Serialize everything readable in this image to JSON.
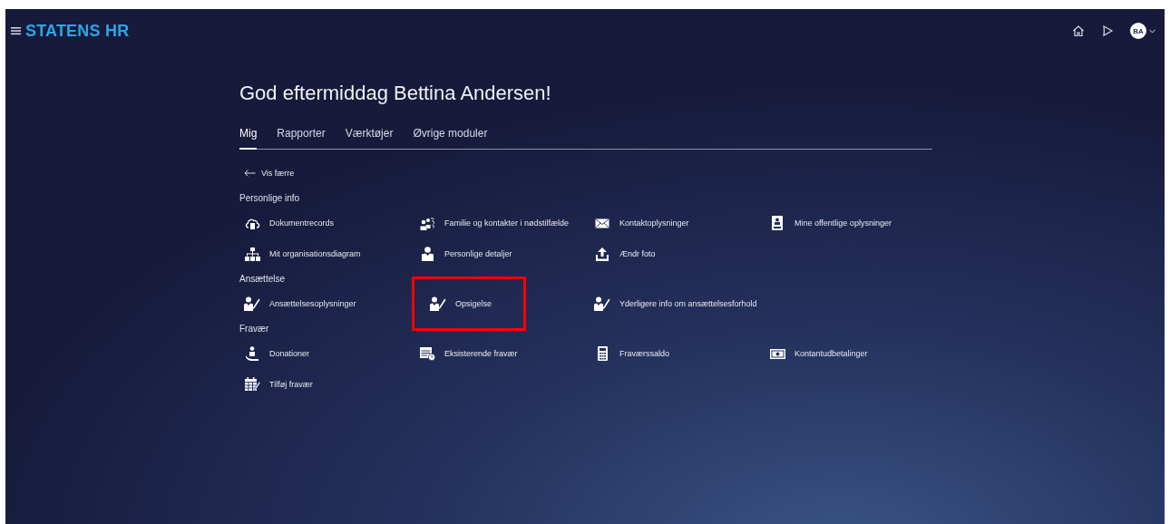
{
  "header": {
    "brand": "STATENS HR",
    "avatar": "BA"
  },
  "greeting": "God eftermiddag Bettina Andersen!",
  "tabs": [
    {
      "label": "Mig",
      "selected": true
    },
    {
      "label": "Rapporter",
      "selected": false
    },
    {
      "label": "Værktøjer",
      "selected": false
    },
    {
      "label": "Øvrige moduler",
      "selected": false
    }
  ],
  "back_link": "Vis færre",
  "sections": [
    {
      "title": "Personlige info",
      "items": [
        {
          "label": "Dokumentrecords",
          "kind": "cloud",
          "highlighted": false
        },
        {
          "label": "Familie og kontakter i nødstilfælde",
          "kind": "family",
          "highlighted": false
        },
        {
          "label": "Kontaktoplysninger",
          "kind": "envelope",
          "highlighted": false
        },
        {
          "label": "Mine offentlige oplysninger",
          "kind": "badge",
          "highlighted": false
        },
        {
          "label": "Mit organisationsdiagram",
          "kind": "org",
          "highlighted": false
        },
        {
          "label": "Personlige detaljer",
          "kind": "person",
          "highlighted": false
        },
        {
          "label": "Ændr foto",
          "kind": "upload",
          "highlighted": false
        }
      ]
    },
    {
      "title": "Ansættelse",
      "items": [
        {
          "label": "Ansættelsesoplysninger",
          "kind": "personedit",
          "highlighted": false
        },
        {
          "label": "Opsigelse",
          "kind": "personedit",
          "highlighted": true
        },
        {
          "label": "Yderligere info om ansættelsesforhold",
          "kind": "personedit",
          "highlighted": false
        }
      ]
    },
    {
      "title": "Fravær",
      "items": [
        {
          "label": "Donationer",
          "kind": "donation",
          "highlighted": false
        },
        {
          "label": "Eksisterende fravær",
          "kind": "calendarclock",
          "highlighted": false
        },
        {
          "label": "Fraværssaldo",
          "kind": "calculator",
          "highlighted": false
        },
        {
          "label": "Kontantudbetalinger",
          "kind": "cash",
          "highlighted": false
        },
        {
          "label": "Tilføj fravær",
          "kind": "calendaredit",
          "highlighted": false
        }
      ]
    }
  ]
}
